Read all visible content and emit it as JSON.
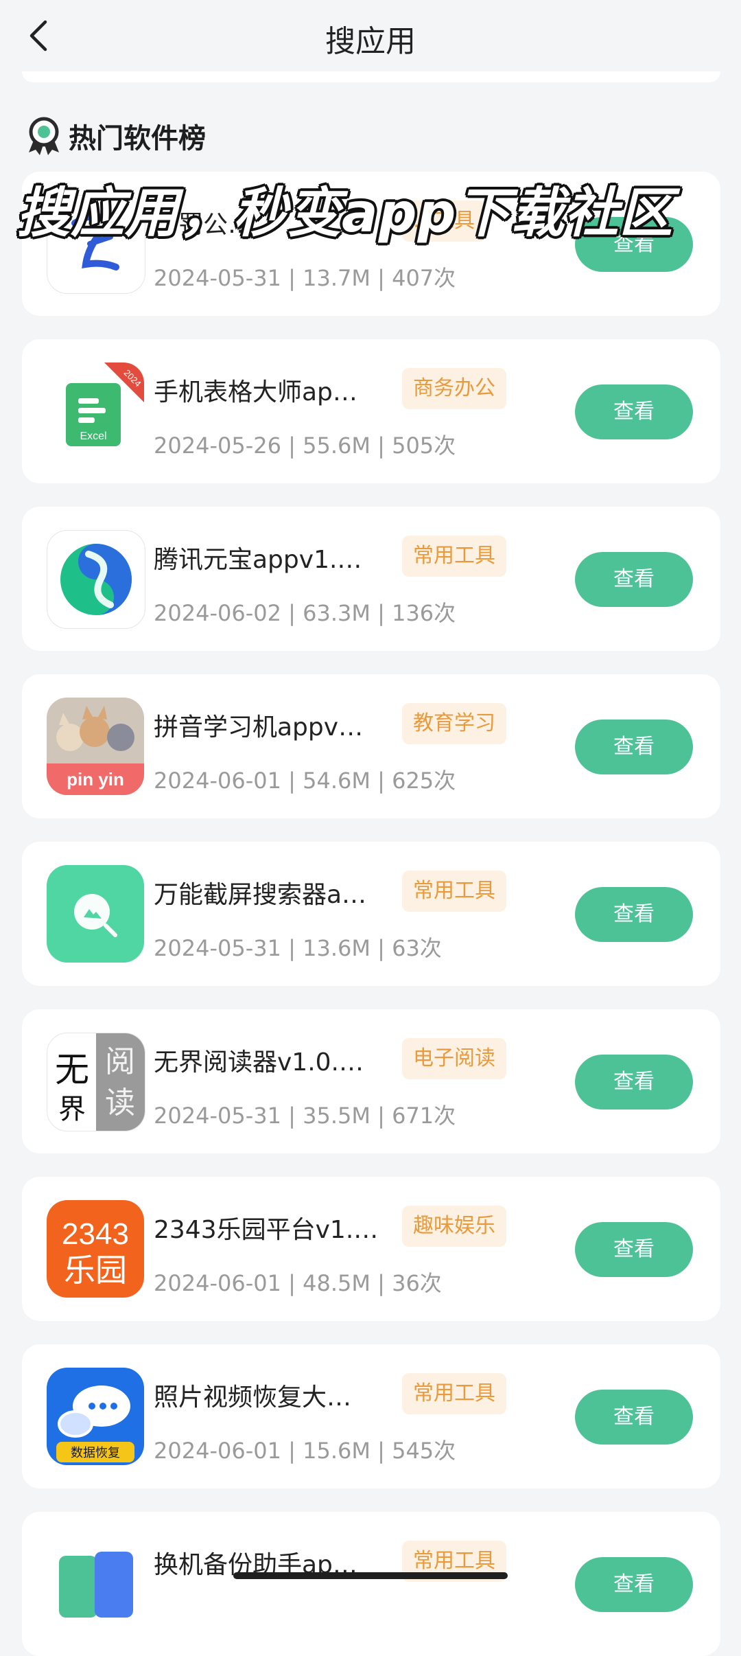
{
  "header": {
    "title": "搜应用",
    "back_icon": "chevron-left-icon"
  },
  "section": {
    "title": "热门软件榜",
    "icon": "award-ribbon-icon"
  },
  "overlay_caption": "搜应用，秒变app下载社区",
  "view_label": "查看",
  "colors": {
    "accent_green": "#4dc297",
    "tag_bg": "#fdf1e3",
    "tag_text": "#e89a3c",
    "meta_gray": "#9a9a9a"
  },
  "apps": [
    {
      "name": "…罚公…",
      "tag": "…工具",
      "date": "2024-05-31",
      "size": "13.7M",
      "count": "407次",
      "icon": "blue-brush-icon"
    },
    {
      "name": "手机表格大师ap…",
      "tag": "商务办公",
      "date": "2024-05-26",
      "size": "55.6M",
      "count": "505次",
      "icon": "excel-sheet-icon",
      "icon_text": "Excel",
      "icon_badge": "2024"
    },
    {
      "name": "腾讯元宝appv1.…",
      "tag": "常用工具",
      "date": "2024-06-02",
      "size": "63.3M",
      "count": "136次",
      "icon": "yuanbao-swirl-icon"
    },
    {
      "name": "拼音学习机appv…",
      "tag": "教育学习",
      "date": "2024-06-01",
      "size": "54.6M",
      "count": "625次",
      "icon": "pinyin-dogs-icon",
      "icon_text": "pin yin"
    },
    {
      "name": "万能截屏搜索器a…",
      "tag": "常用工具",
      "date": "2024-05-31",
      "size": "13.6M",
      "count": "63次",
      "icon": "screenshot-search-icon"
    },
    {
      "name": "无界阅读器v1.0.…",
      "tag": "电子阅读",
      "date": "2024-05-31",
      "size": "35.5M",
      "count": "671次",
      "icon": "calligraphy-reader-icon",
      "icon_chars": [
        "无",
        "阅",
        "界",
        "读"
      ]
    },
    {
      "name": "2343乐园平台v1.…",
      "tag": "趣味娱乐",
      "date": "2024-06-01",
      "size": "48.5M",
      "count": "36次",
      "icon": "park-2343-icon",
      "icon_line1": "2343",
      "icon_line2": "乐园"
    },
    {
      "name": "照片视频恢复大…",
      "tag": "常用工具",
      "date": "2024-06-01",
      "size": "15.6M",
      "count": "545次",
      "icon": "data-recovery-chat-icon",
      "icon_text": "数据恢复"
    },
    {
      "name": "换机备份助手ap…",
      "tag": "常用工具",
      "date": "",
      "size": "",
      "count": "",
      "icon": "phone-backup-icon"
    }
  ]
}
